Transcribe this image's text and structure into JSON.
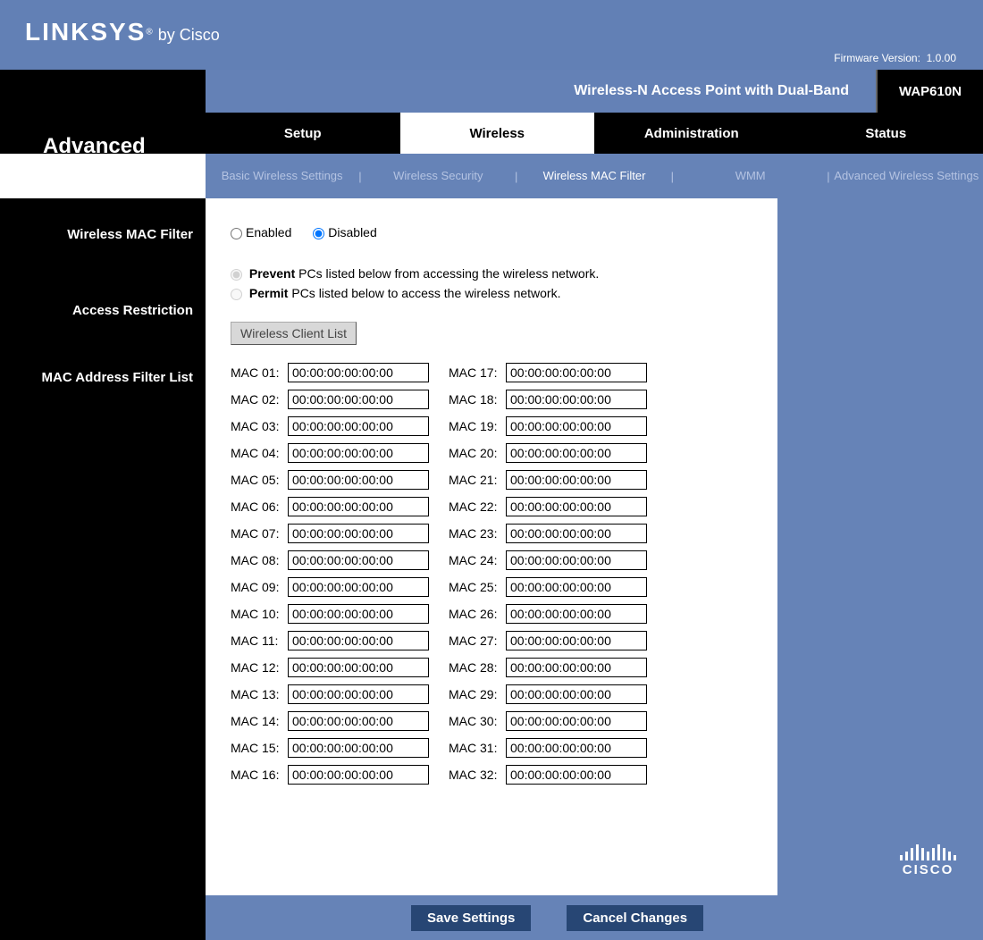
{
  "brand": {
    "name1": "LINKSYS",
    "reg": "®",
    "name2": "by Cisco"
  },
  "firmware": {
    "label": "Firmware Version:",
    "value": "1.0.00"
  },
  "product": {
    "title": "Wireless-N Access Point with Dual-Band",
    "model": "WAP610N"
  },
  "page_title": "Advanced",
  "maintabs": [
    "Setup",
    "Wireless",
    "Administration",
    "Status"
  ],
  "subtabs": [
    "Basic Wireless Settings",
    "Wireless Security",
    "Wireless MAC Filter",
    "WMM",
    "Advanced Wireless Settings"
  ],
  "left_sections": [
    "Wireless MAC Filter",
    "Access Restriction",
    "MAC Address Filter List"
  ],
  "filter": {
    "enabled_label": "Enabled",
    "disabled_label": "Disabled",
    "selected": "disabled",
    "prevent_bold": "Prevent",
    "prevent_text": " PCs listed below from accessing the wireless network.",
    "permit_bold": "Permit",
    "permit_text": " PCs listed below to access the wireless network.",
    "restrict_selected": "prevent",
    "client_list_btn": "Wireless Client List"
  },
  "mac": {
    "label_prefix": "MAC ",
    "count": 32,
    "default": "00:00:00:00:00:00"
  },
  "buttons": {
    "save": "Save Settings",
    "cancel": "Cancel Changes"
  },
  "cisco": "CISCO"
}
